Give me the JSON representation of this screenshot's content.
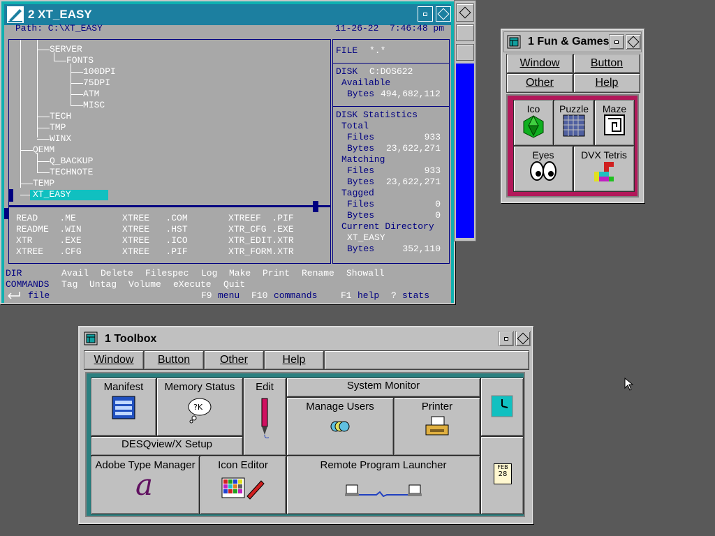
{
  "xtree": {
    "title": "2  XT_EASY",
    "path": "Path: C:\\XT_EASY",
    "datetime": "11-26-22  7:46:48 pm",
    "tree": [
      "SERVER",
      "FONTS",
      "100DPI",
      "75DPI",
      "ATM",
      "MISC",
      "TECH",
      "TMP",
      "WINX",
      "QEMM",
      "Q_BACKUP",
      "TECHNOTE",
      "TEMP",
      "XT_EASY"
    ],
    "files": [
      [
        "READ    .ME",
        "XTREE   .COM",
        "XTREEF  .PIF"
      ],
      [
        "README  .WIN",
        "XTREE   .HST",
        "XTR_CFG .EXE"
      ],
      [
        "XTR     .EXE",
        "XTREE   .ICO",
        "XTR_EDIT.XTR"
      ],
      [
        "XTREE   .CFG",
        "XTREE   .PIF",
        "XTR_FORM.XTR"
      ]
    ],
    "stats": {
      "file_label": "FILE",
      "file_spec": "*.*",
      "disk_label": "DISK",
      "disk_name": "C:DOS622",
      "available": "Available",
      "bytes_label": "Bytes",
      "available_bytes": "494,682,112",
      "disk_stats": "DISK Statistics",
      "total": "Total",
      "files_label": "Files",
      "total_files": "933",
      "total_bytes": "23,622,271",
      "matching": "Matching",
      "matching_files": "933",
      "matching_bytes": "23,622,271",
      "tagged": "Tagged",
      "tagged_files": "0",
      "tagged_bytes": "0",
      "current_dir": "Current Directory",
      "current_dir_name": "XT_EASY",
      "current_bytes": "352,110"
    },
    "commands": {
      "dir": "DIR",
      "commands_label": "COMMANDS",
      "row1": [
        "Avail",
        "Delete",
        "Filespec",
        "Log",
        "Make",
        "Print",
        "Rename",
        "Showall"
      ],
      "row2": [
        "Tag",
        "Untag",
        "Volume",
        "eXecute",
        "Quit"
      ],
      "file_hint": "file",
      "f9": "F9",
      "f9_label": "menu",
      "f10": "F10",
      "f10_label": "commands",
      "f1": "F1",
      "f1_label": "help",
      "q": "?",
      "q_label": "stats"
    }
  },
  "fun": {
    "title": "1  Fun & Games",
    "menu": [
      "Window",
      "Button",
      "Other",
      "Help"
    ],
    "tiles": [
      "Ico",
      "Puzzle",
      "Maze",
      "Eyes",
      "DVX Tetris"
    ]
  },
  "toolbox": {
    "title": "1  Toolbox",
    "menu": [
      "Window",
      "Button",
      "Other",
      "Help"
    ],
    "tiles": {
      "manifest": "Manifest",
      "memory": "Memory Status",
      "edit": "Edit",
      "system_monitor": "System Monitor",
      "manage_users": "Manage Users",
      "printer": "Printer",
      "desqview_setup": "DESQview/X Setup",
      "atm": "Adobe Type Manager",
      "icon_editor": "Icon Editor",
      "remote": "Remote Program Launcher",
      "calendar_month": "FEB",
      "calendar_day": "28"
    }
  }
}
